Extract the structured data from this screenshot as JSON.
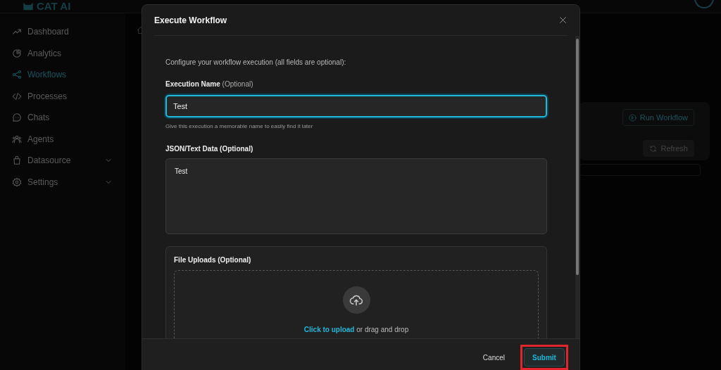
{
  "logo": {
    "text": "CAT AI"
  },
  "sidebar": {
    "items": [
      {
        "label": "Dashboard",
        "selected": false,
        "has_submenu": false
      },
      {
        "label": "Analytics",
        "selected": false,
        "has_submenu": false
      },
      {
        "label": "Workflows",
        "selected": true,
        "has_submenu": false
      },
      {
        "label": "Processes",
        "selected": false,
        "has_submenu": false
      },
      {
        "label": "Chats",
        "selected": false,
        "has_submenu": false
      },
      {
        "label": "Agents",
        "selected": false,
        "has_submenu": false
      },
      {
        "label": "Datasource",
        "selected": false,
        "has_submenu": true
      },
      {
        "label": "Settings",
        "selected": false,
        "has_submenu": true
      }
    ]
  },
  "page": {
    "buttons": [
      {
        "label": "Run Workflow",
        "kind": "run"
      },
      {
        "label": "Refresh",
        "kind": "refresh"
      }
    ]
  },
  "dialog": {
    "title": "Execute Workflow",
    "intro": "Configure your workflow execution (all fields are optional):",
    "name_field": {
      "label": "**Execution Name** (Optional)",
      "value": "Test",
      "focused": true,
      "hint": "Give this execution a memorable name to easily find it later"
    },
    "data_field": {
      "label": "JSON/Text Data (Optional)",
      "value": "Test"
    },
    "uploads": {
      "label": "File Uploads (Optional)",
      "link": "Click to upload",
      "text": "or drag and drop"
    },
    "footer": {
      "cancel": "Cancel",
      "submit": "Submit",
      "submit_highlighted": true
    }
  }
}
